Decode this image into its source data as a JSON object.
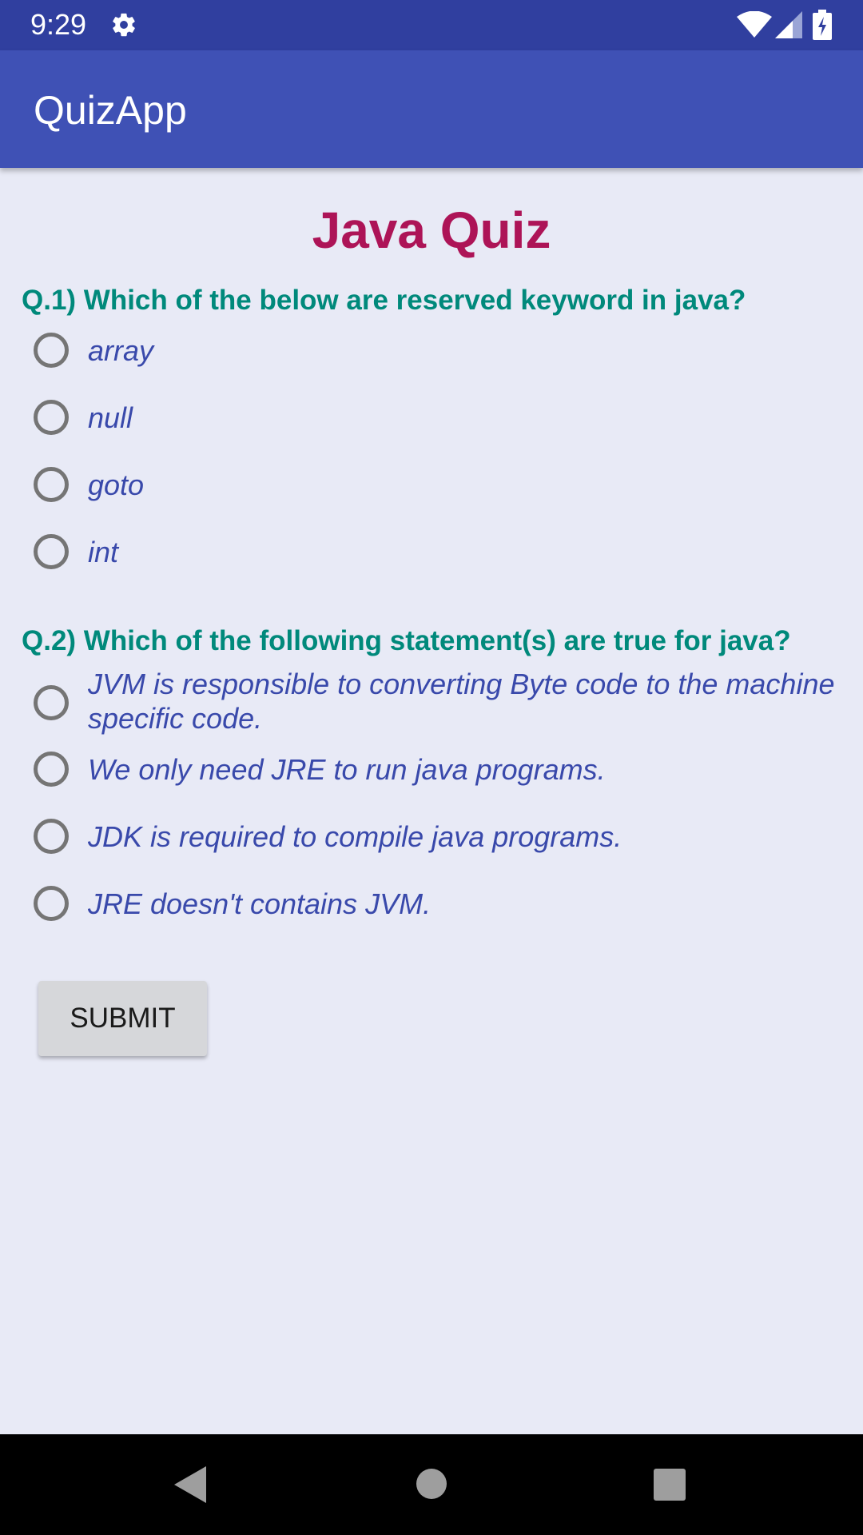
{
  "status_bar": {
    "time": "9:29"
  },
  "app_bar": {
    "title": "QuizApp"
  },
  "quiz": {
    "title": "Java Quiz",
    "questions": [
      {
        "text": "Q.1) Which of the below are reserved keyword in java?",
        "options": [
          "array",
          "null",
          "goto",
          "int"
        ]
      },
      {
        "text": "Q.2) Which of the following statement(s) are true for java?",
        "options": [
          "JVM is responsible to converting Byte code to the machine specific code.",
          "We only need JRE to run java programs.",
          "JDK is required to compile java programs.",
          "JRE doesn't contains JVM."
        ]
      }
    ],
    "submit_label": "SUBMIT"
  },
  "colors": {
    "status_bar": "#303f9f",
    "app_bar": "#3f51b5",
    "background": "#e8eaf6",
    "title": "#ad1457",
    "question": "#00897b",
    "option": "#3949ab"
  },
  "icons": [
    "gear-icon",
    "wifi-icon",
    "signal-icon",
    "battery-icon",
    "back-icon",
    "home-icon",
    "recents-icon"
  ]
}
